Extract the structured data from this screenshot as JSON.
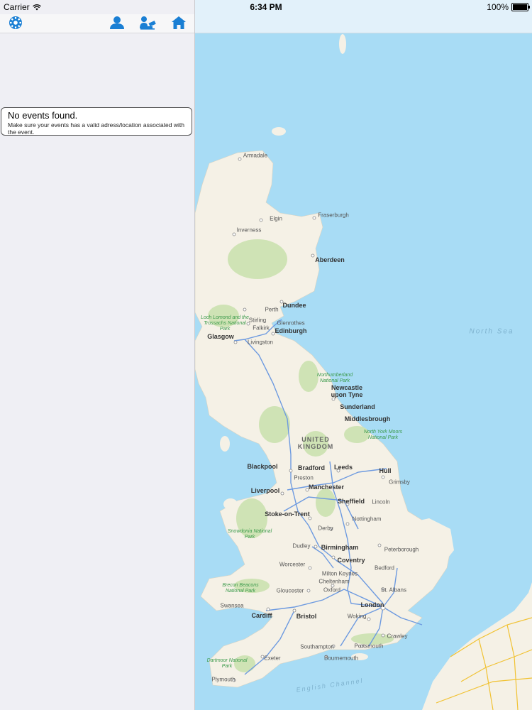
{
  "status_bar": {
    "carrier": "Carrier",
    "time": "6:34 PM",
    "battery": "100%"
  },
  "toolbar": {
    "buttons": [
      {
        "name": "settings",
        "icon": "gear-icon"
      },
      {
        "name": "profile",
        "icon": "user-icon"
      },
      {
        "name": "checkin",
        "icon": "user-desk-icon"
      },
      {
        "name": "home",
        "icon": "home-icon"
      }
    ]
  },
  "message": {
    "title": "No events found.",
    "body": "Make sure your events has a valid adress/location associated with the event."
  },
  "map": {
    "colors": {
      "water": "#a8dcf5",
      "land": "#f5f1e6",
      "park": "#cfe3b5",
      "road": "#6d9ae0"
    },
    "labels": {
      "armadale": "Armadale",
      "elgin": "Elgin",
      "fraserburgh": "Fraserburgh",
      "inverness": "Inverness",
      "aberdeen": "Aberdeen",
      "perth": "Perth",
      "dundee": "Dundee",
      "stirling": "Stirling",
      "glenrothes": "Glenrothes",
      "falkirk": "Falkirk",
      "glasgow": "Glasgow",
      "edinburgh": "Edinburgh",
      "livingston": "Livingston",
      "newcastle": "Newcastle upon Tyne",
      "sunderland": "Sunderland",
      "middlesbrough": "Middlesbrough",
      "blackpool": "Blackpool",
      "bradford": "Bradford",
      "leeds": "Leeds",
      "hull": "Hull",
      "preston": "Preston",
      "grimsby": "Grimsby",
      "manchester": "Manchester",
      "liverpool": "Liverpool",
      "sheffield": "Sheffield",
      "lincoln": "Lincoln",
      "stoke": "Stoke-on-Trent",
      "nottingham": "Nottingham",
      "derby": "Derby",
      "peterborough": "Peterborough",
      "dudley": "Dudley",
      "birmingham": "Birmingham",
      "coventry": "Coventry",
      "worcester": "Worcester",
      "bedford": "Bedford",
      "milton_keynes": "Milton Keynes",
      "cheltenham": "Cheltenham",
      "gloucester": "Gloucester",
      "oxford": "Oxford",
      "st_albans": "St. Albans",
      "swansea": "Swansea",
      "london": "London",
      "cardiff": "Cardiff",
      "bristol": "Bristol",
      "woking": "Woking",
      "crawley": "Crawley",
      "southampton": "Southampton",
      "portsmouth": "Portsmouth",
      "bournemouth": "Bournemouth",
      "exeter": "Exeter",
      "plymouth": "Plymouth"
    },
    "parks": {
      "loch_lomond": "Loch Lomond and the Trossachs National Park",
      "northumberland": "Northumberland National Park",
      "north_york": "North York Moors National Park",
      "snowdonia": "Snowdonia National Park",
      "brecon": "Brecon Beacons National Park",
      "dartmoor": "Dartmoor National Park"
    },
    "sea": {
      "north_sea": "North Sea",
      "channel": "English Channel"
    },
    "country": "UNITED KINGDOM"
  }
}
